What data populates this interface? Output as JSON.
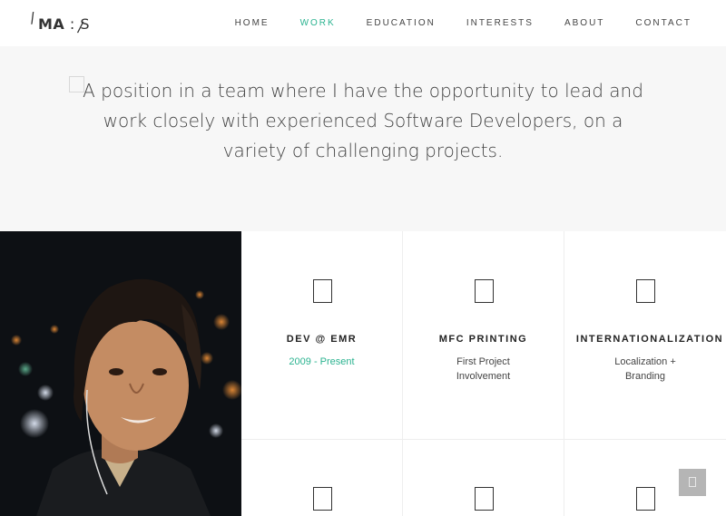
{
  "header": {
    "logo": {
      "text_bold": "MA",
      "text_sep": ":",
      "text_light": "S"
    },
    "nav": [
      {
        "label": "HOME",
        "active": false
      },
      {
        "label": "WORK",
        "active": true
      },
      {
        "label": "EDUCATION",
        "active": false
      },
      {
        "label": "INTERESTS",
        "active": false
      },
      {
        "label": "ABOUT",
        "active": false
      },
      {
        "label": "CONTACT",
        "active": false
      }
    ]
  },
  "hero": {
    "quote_icon": "quote-icon",
    "text": "A position in a team where I have the opportunity to lead and work closely with experienced Software Developers, on a variety of challenging projects."
  },
  "work": {
    "items": [
      {
        "title": "DEV @ EMR",
        "subtitle": "2009 - Present",
        "icon": "placeholder-icon"
      },
      {
        "title": "MFC PRINTING",
        "subtitle": "First Project Involvement",
        "icon": "placeholder-icon"
      },
      {
        "title": "INTERNATIONALIZATION",
        "subtitle": "Localization + Branding",
        "icon": "placeholder-icon"
      },
      {
        "title": "",
        "subtitle": "",
        "icon": "placeholder-icon"
      },
      {
        "title": "",
        "subtitle": "",
        "icon": "placeholder-icon"
      },
      {
        "title": "",
        "subtitle": "",
        "icon": "placeholder-icon"
      }
    ]
  },
  "colors": {
    "accent": "#2bb390",
    "hero_bg": "#f7f7f7",
    "scroll_button": "#b5b5b5"
  }
}
